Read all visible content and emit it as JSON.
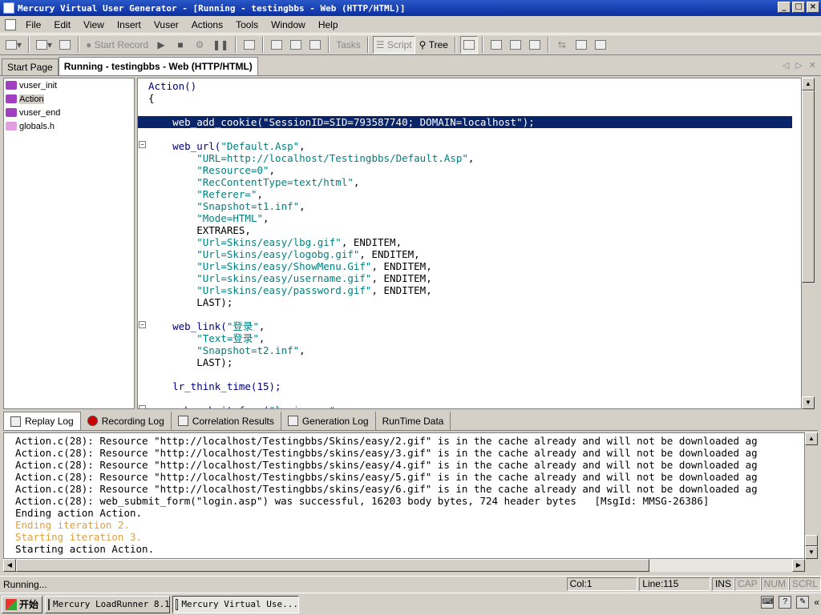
{
  "window": {
    "title": "Mercury Virtual User Generator - [Running - testingbbs - Web (HTTP/HTML)]",
    "min": "_",
    "max": "□",
    "close": "×"
  },
  "menu": [
    "File",
    "Edit",
    "View",
    "Insert",
    "Vuser",
    "Actions",
    "Tools",
    "Window",
    "Help"
  ],
  "toolbar": {
    "start_record": "Start Record",
    "tasks": "Tasks",
    "script": "Script",
    "tree": "Tree"
  },
  "doc_tabs": [
    {
      "label": "Start Page",
      "active": false
    },
    {
      "label": "Running - testingbbs - Web (HTTP/HTML)",
      "active": true
    }
  ],
  "tree_items": [
    {
      "label": "vuser_init",
      "selected": false
    },
    {
      "label": "Action",
      "selected": true
    },
    {
      "label": "vuser_end",
      "selected": false
    },
    {
      "label": "globals.h",
      "selected": false
    }
  ],
  "code_lines": [
    "Action()",
    "{",
    "",
    "    web_add_cookie(\"SessionID=SID=793587740; DOMAIN=localhost\");",
    "",
    "    web_url(\"Default.Asp\",",
    "        \"URL=http://localhost/Testingbbs/Default.Asp\",",
    "        \"Resource=0\",",
    "        \"RecContentType=text/html\",",
    "        \"Referer=\",",
    "        \"Snapshot=t1.inf\",",
    "        \"Mode=HTML\",",
    "        EXTRARES,",
    "        \"Url=Skins/easy/lbg.gif\", ENDITEM,",
    "        \"Url=Skins/easy/logobg.gif\", ENDITEM,",
    "        \"Url=Skins/easy/ShowMenu.Gif\", ENDITEM,",
    "        \"Url=skins/easy/username.gif\", ENDITEM,",
    "        \"Url=skins/easy/password.gif\", ENDITEM,",
    "        LAST);",
    "",
    "    web_link(\"登录\",",
    "        \"Text=登录\",",
    "        \"Snapshot=t2.inf\",",
    "        LAST);",
    "",
    "    lr_think_time(15);",
    "",
    "    web_submit_form(\"login.asp\","
  ],
  "highlighted_line": 3,
  "log_tabs": [
    {
      "label": "Replay Log",
      "active": true
    },
    {
      "label": "Recording Log",
      "active": false
    },
    {
      "label": "Correlation Results",
      "active": false
    },
    {
      "label": "Generation Log",
      "active": false
    },
    {
      "label": "RunTime Data",
      "active": false
    }
  ],
  "log_lines": [
    {
      "text": "Action.c(28): Resource \"http://localhost/Testingbbs/Skins/easy/2.gif\" is in the cache already and will not be downloaded ag",
      "style": "normal"
    },
    {
      "text": "Action.c(28): Resource \"http://localhost/Testingbbs/skins/easy/3.gif\" is in the cache already and will not be downloaded ag",
      "style": "normal"
    },
    {
      "text": "Action.c(28): Resource \"http://localhost/Testingbbs/skins/easy/4.gif\" is in the cache already and will not be downloaded ag",
      "style": "normal"
    },
    {
      "text": "Action.c(28): Resource \"http://localhost/Testingbbs/skins/easy/5.gif\" is in the cache already and will not be downloaded ag",
      "style": "normal"
    },
    {
      "text": "Action.c(28): Resource \"http://localhost/Testingbbs/skins/easy/6.gif\" is in the cache already and will not be downloaded ag",
      "style": "normal"
    },
    {
      "text": "Action.c(28): web_submit_form(\"login.asp\") was successful, 16203 body bytes, 724 header bytes   [MsgId: MMSG-26386]",
      "style": "normal"
    },
    {
      "text": "Ending action Action.",
      "style": "normal"
    },
    {
      "text": "Ending iteration 2.",
      "style": "orange"
    },
    {
      "text": "Starting iteration 3.",
      "style": "orange"
    },
    {
      "text": "Starting action Action.",
      "style": "normal"
    }
  ],
  "status": {
    "text": "Running...",
    "col": "Col:1",
    "line": "Line:115",
    "ins": "INS",
    "cap": "CAP",
    "num": "NUM",
    "scrl": "SCRL"
  },
  "taskbar": {
    "start": "开始",
    "tasks": [
      {
        "label": "Mercury LoadRunner 8.1",
        "active": false
      },
      {
        "label": "Mercury Virtual Use...",
        "active": true
      }
    ],
    "tray_more": "«"
  },
  "colors": {
    "title_bar": "#0b2fa0",
    "selection": "#0a246a",
    "function": "#000080",
    "string": "#008080",
    "log_orange": "#e0a040"
  }
}
